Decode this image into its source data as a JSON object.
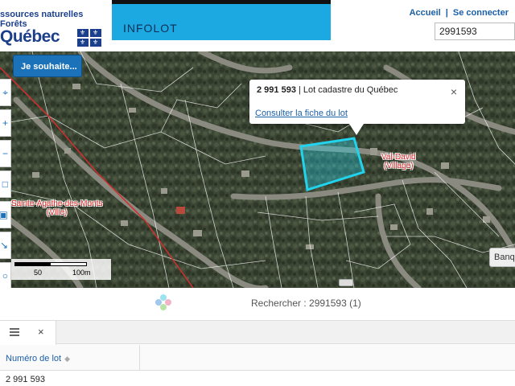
{
  "header": {
    "logo_line1": "ssources naturelles",
    "logo_line2": "Forêts",
    "logo_wordmark": "Québec",
    "app_title": "INFOLOT",
    "link_home": "Accueil",
    "link_separator": "|",
    "link_login": "Se connecter",
    "search_value": "2991593"
  },
  "map": {
    "wish_button": "Je souhaite...",
    "popup": {
      "lot_number": "2 991 593",
      "lot_type": "| Lot cadastre du Québec",
      "link": "Consulter la fiche du lot",
      "close": "×"
    },
    "labels": {
      "val_david_1": "Val-David",
      "val_david_2": "(Village)",
      "sainte_agathe_1": "Sainte-Agathe-des-Monts",
      "sainte_agathe_2": "(Ville)"
    },
    "scale": {
      "mid": "50",
      "end": "100m"
    },
    "banq_button": "Banq",
    "colors": {
      "parcel": "#22d3ee",
      "cadastre_lines": "#ffffff",
      "municipal_boundary": "#d42c2c"
    }
  },
  "results": {
    "search_text": "Rechercher : 2991593 (1)",
    "tab_close": "×",
    "table": {
      "column_header": "Numéro de lot",
      "rows": [
        "2 991 593"
      ]
    }
  }
}
